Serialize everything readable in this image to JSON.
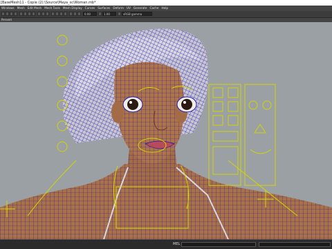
{
  "window": {
    "title": "[BaseMesh11 - Copie (2):\\Source\\Maya_sc\\Woman.mb*"
  },
  "menu": {
    "items": [
      "Windows",
      "Mesh",
      "Edit Mesh",
      "Mesh Tools",
      "Mesh Display",
      "Curves",
      "Surfaces",
      "Deform",
      "UV",
      "Generate",
      "Cache",
      "Help"
    ]
  },
  "toolbar": {
    "value_a": "0.00",
    "value_b": "1.00",
    "colorspace": "sRGB gamma"
  },
  "panel": {
    "label": "Persent"
  },
  "status": {
    "label": "MEL"
  },
  "colors": {
    "wire": "#1a1ab0",
    "control": "#d4d400",
    "background": "#9aa0a4",
    "skin": "#a9714a"
  }
}
